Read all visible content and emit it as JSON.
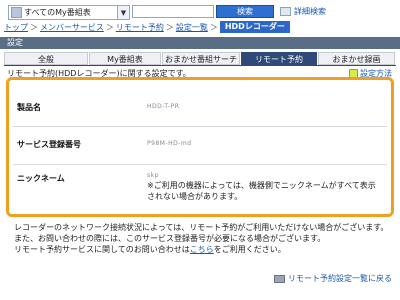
{
  "search": {
    "scope_selected": "すべてのMy番組表",
    "keyword_value": "",
    "search_button": "検索",
    "advanced_search": "詳細検索"
  },
  "breadcrumb": {
    "items": [
      "トップ",
      "メンバーサービス",
      "リモート予約",
      "設定一覧"
    ],
    "current": "HDDレコーダー"
  },
  "settings_header": "設定",
  "tabs": [
    "全般",
    "My番組表",
    "おまかせ番組サーチ",
    "リモート予約",
    "おまかせ録画"
  ],
  "description": "リモート予約(HDDレコーダー)に関する設定です。",
  "help_link": "設定方法",
  "fields": {
    "product_name_label": "製品名",
    "product_name_value": "HDD-T-PR",
    "service_id_label": "サービス登録番号",
    "service_id_value": "P98M-HD-md",
    "nickname_label": "ニックネーム",
    "nickname_value": "skp",
    "nickname_note": "※ご利用の機器によっては、機器側でニックネームがすべて表示されない場合があります。"
  },
  "footer_notes": {
    "line1": "レコーダーのネットワーク接続状況によっては、リモート予約がご利用いただけない場合がございます。",
    "line2": "また、お問い合わせの際には、このサービス登録番号が必要になる場合がございます。",
    "line3_prefix": "リモート予約サービスに関してのお問い合わせは",
    "line3_link": "こちら",
    "line3_suffix": "をご利用ください。"
  },
  "back_link": "リモート予約設定一覧に戻る"
}
